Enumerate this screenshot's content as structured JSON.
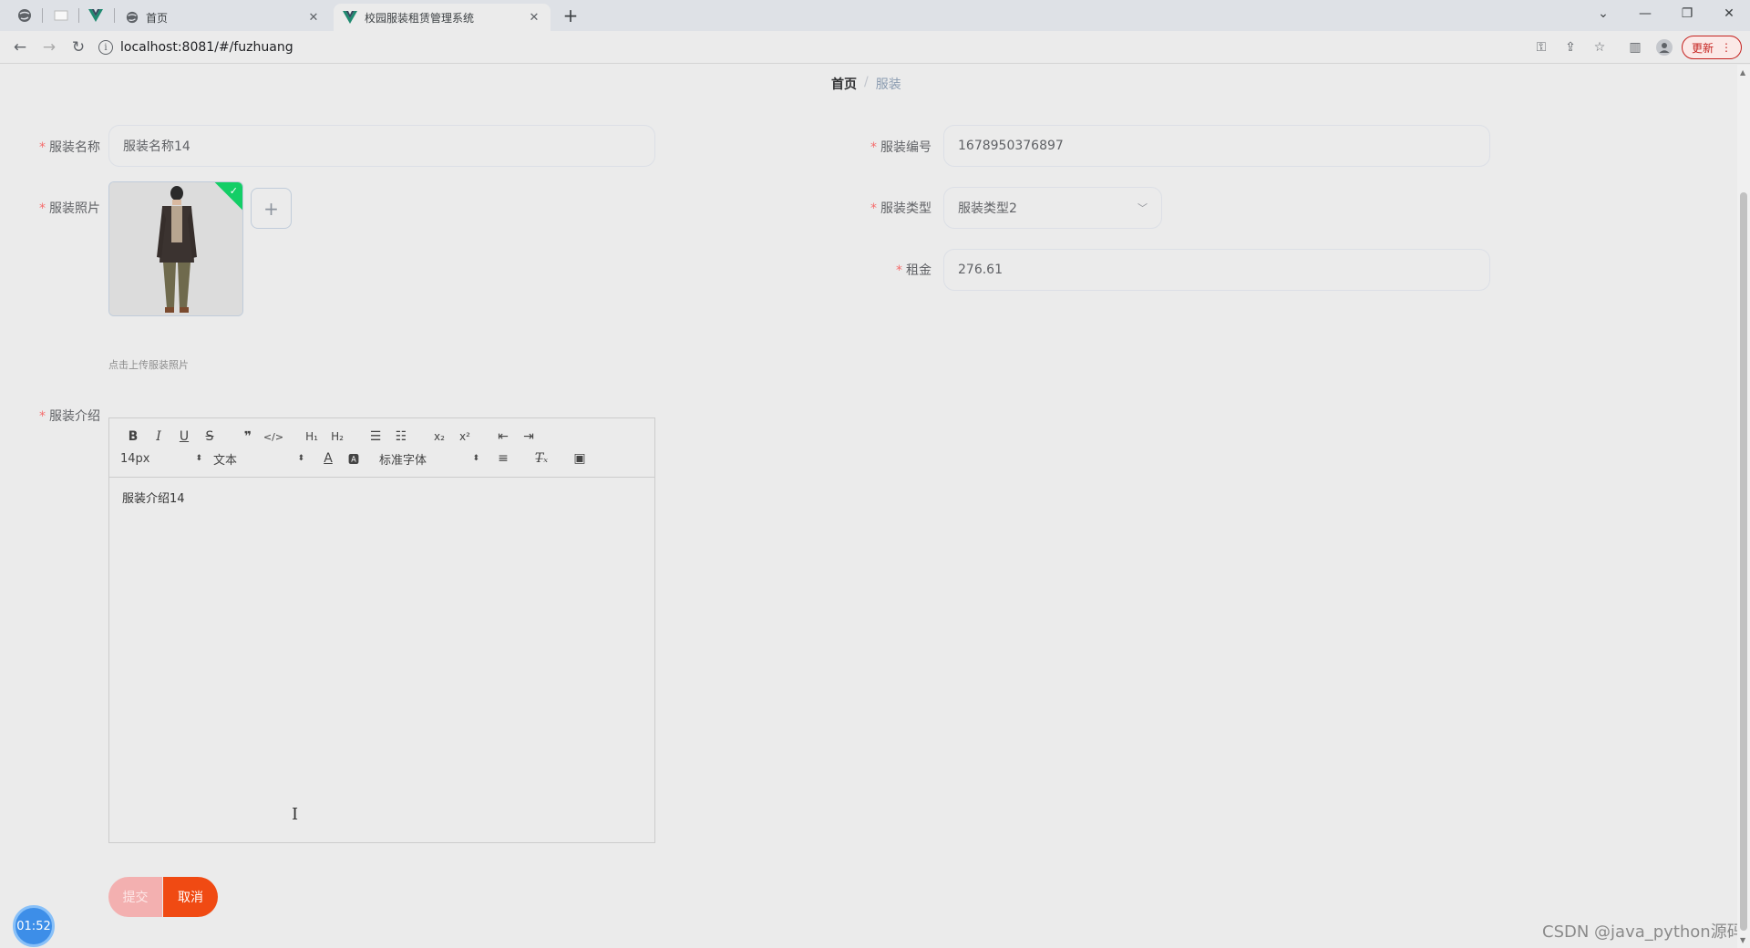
{
  "browser": {
    "tabs": [
      {
        "title": "首页"
      },
      {
        "title": "校园服装租赁管理系统"
      }
    ],
    "url": "localhost:8081/#/fuzhuang",
    "update_label": "更新"
  },
  "breadcrumb": {
    "home": "首页",
    "separator": "/",
    "current": "服装"
  },
  "form": {
    "name": {
      "label": "服装名称",
      "value": "服装名称14"
    },
    "number": {
      "label": "服装编号",
      "value": "1678950376897"
    },
    "photo": {
      "label": "服装照片",
      "hint": "点击上传服装照片"
    },
    "type": {
      "label": "服装类型",
      "value": "服装类型2"
    },
    "rent": {
      "label": "租金",
      "value": "276.61"
    },
    "intro": {
      "label": "服装介绍",
      "content": "服装介绍14",
      "toolbar": {
        "size": "14px",
        "header": "文本",
        "font": "标准字体"
      }
    },
    "required_mark": "*"
  },
  "buttons": {
    "submit": "提交",
    "cancel": "取消"
  },
  "overlay": {
    "timer": "01:52",
    "watermark": "CSDN @java_python源码"
  },
  "colors": {
    "accent": "#f04a13",
    "required": "#f56c6c",
    "success": "#13ce66"
  }
}
